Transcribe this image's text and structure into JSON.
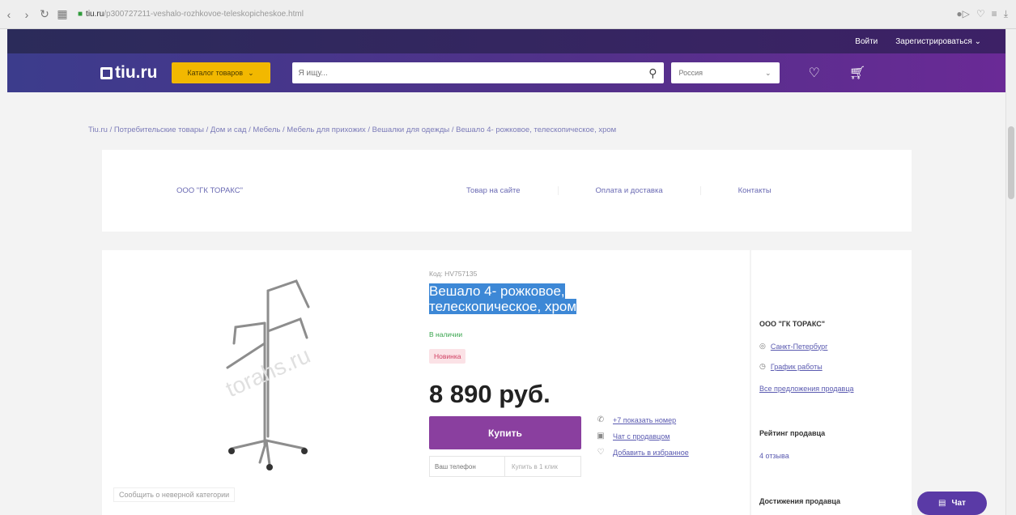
{
  "browser": {
    "url_host": "tiu.ru",
    "url_path": "/p300727211-veshalo-rozhkovoe-teleskopicheskoe.html"
  },
  "topbar": {
    "login": "Войти",
    "register": "Зарегистрироваться"
  },
  "header": {
    "logo": "tiu.ru",
    "catalog": "Каталог товаров",
    "search_placeholder": "Я ищу...",
    "region": "Россия"
  },
  "breadcrumb": "Tiu.ru / Потребительские товары / Дом и сад / Мебель / Мебель для прихожих / Вешалки для одежды / Вешало 4- рожковое, телескопическое, хром",
  "seller_bar": {
    "seller": "ООО \"ГК ТОРАКС\"",
    "tabs": [
      "Товар на сайте",
      "Оплата и доставка",
      "Контакты"
    ]
  },
  "product": {
    "sku": "Код: HV757135",
    "title_line1": "Вешало 4- рожковое,",
    "title_line2": "телескопическое, хром",
    "stock": "В наличии",
    "badge": "Новинка",
    "price": "8 890 руб.",
    "buy": "Купить",
    "phone_placeholder": "Ваш телефон",
    "one_click": "Купить в 1 клик",
    "watermark": "torahs.ru",
    "report": "Сообщить о неверной категории",
    "actions": [
      {
        "icon": "phone-icon",
        "label": "+7 показать номер"
      },
      {
        "icon": "chat-icon",
        "label": "Чат с продавцом"
      },
      {
        "icon": "heart-icon",
        "label": "Добавить в избранное"
      }
    ]
  },
  "sidebar": {
    "company": "ООО \"ГК ТОРАКС\"",
    "city": "Санкт-Петербург",
    "schedule": "График работы",
    "all_offers": "Все предложения продавца",
    "rating_title": "Рейтинг продавца",
    "reviews": "4 отзыва",
    "achievements_title": "Достижения продавца"
  },
  "chat": {
    "label": "Чат"
  }
}
